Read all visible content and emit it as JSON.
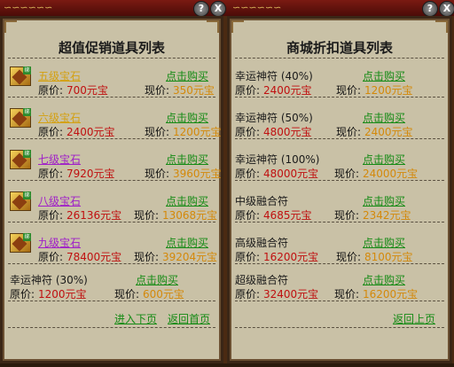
{
  "window": {
    "help_label": "?",
    "close_label": "X"
  },
  "left": {
    "title": "超值促销道具列表",
    "price_label": "原价:",
    "current_label": "现价:",
    "buy_label": "点击购买",
    "items": [
      {
        "name": "五级宝石",
        "name_color": "#d4a010",
        "original": "700元宝",
        "current": "350元宝"
      },
      {
        "name": "六级宝石",
        "name_color": "#d4a010",
        "original": "2400元宝",
        "current": "1200元宝"
      },
      {
        "name": "七级宝石",
        "name_color": "#a020c8",
        "original": "7920元宝",
        "current": "3960元宝"
      },
      {
        "name": "八级宝石",
        "name_color": "#a020c8",
        "original": "26136元宝",
        "current": "13068元宝"
      },
      {
        "name": "九级宝石",
        "name_color": "#a020c8",
        "original": "78400元宝",
        "current": "39204元宝"
      }
    ],
    "extra_item": {
      "name": "幸运神符 (30%)",
      "original": "1200元宝",
      "current": "600元宝"
    },
    "next_page": "进入下页",
    "home_page": "返回首页"
  },
  "right": {
    "title": "商城折扣道具列表",
    "price_label": "原价:",
    "current_label": "现价:",
    "buy_label": "点击购买",
    "items": [
      {
        "name": "幸运神符 (40%)",
        "original": "2400元宝",
        "current": "1200元宝"
      },
      {
        "name": "幸运神符 (50%)",
        "original": "4800元宝",
        "current": "2400元宝"
      },
      {
        "name": "幸运神符 (100%)",
        "original": "48000元宝",
        "current": "24000元宝"
      },
      {
        "name": "中级融合符",
        "original": "4685元宝",
        "current": "2342元宝"
      },
      {
        "name": "高级融合符",
        "original": "16200元宝",
        "current": "8100元宝"
      },
      {
        "name": "超级融合符",
        "original": "32400元宝",
        "current": "16200元宝"
      }
    ],
    "prev_page": "返回上页"
  }
}
